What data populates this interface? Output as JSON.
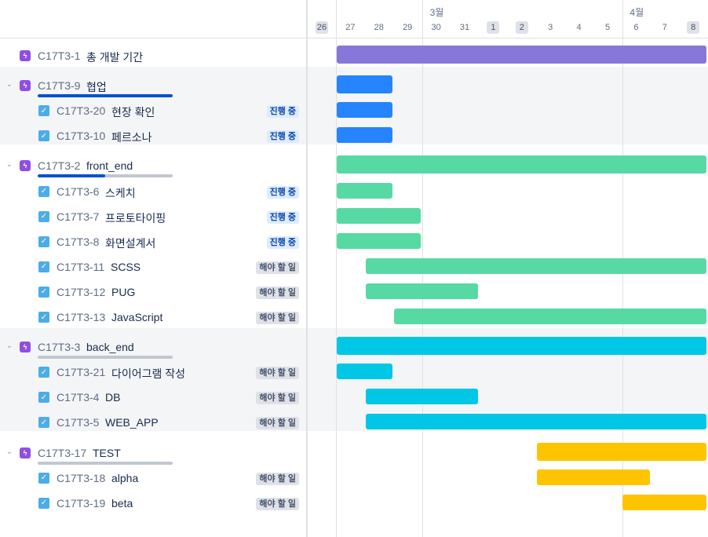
{
  "colors": {
    "epic": "#904ee2",
    "task": "#4bade8",
    "purple": "#8777d9",
    "blue": "#2684ff",
    "green": "#57d9a3",
    "cyan": "#00c7e6",
    "yellow": "#ffc400"
  },
  "timeline": {
    "months": [
      {
        "label": "3월",
        "day_index": 4
      },
      {
        "label": "4월",
        "day_index": 11
      }
    ],
    "days": [
      {
        "label": "26",
        "weekend": true
      },
      {
        "label": "27",
        "weekend": false
      },
      {
        "label": "28",
        "weekend": false
      },
      {
        "label": "29",
        "weekend": false
      },
      {
        "label": "30",
        "weekend": false
      },
      {
        "label": "31",
        "weekend": false
      },
      {
        "label": "1",
        "weekend": true
      },
      {
        "label": "2",
        "weekend": true
      },
      {
        "label": "3",
        "weekend": false
      },
      {
        "label": "4",
        "weekend": false
      },
      {
        "label": "5",
        "weekend": false
      },
      {
        "label": "6",
        "weekend": false
      },
      {
        "label": "7",
        "weekend": false
      },
      {
        "label": "8",
        "weekend": true
      }
    ]
  },
  "rows": [
    {
      "type": "epic",
      "key": "C17T3-1",
      "summary": "총 개발 기간",
      "band": false,
      "chevron": false,
      "progress": null,
      "status": null,
      "bar": {
        "start": 1,
        "end": 13,
        "color": "purple"
      }
    },
    {
      "type": "epic",
      "key": "C17T3-9",
      "summary": "협업",
      "band": true,
      "chevron": true,
      "progress": 1.0,
      "status": null,
      "bar": {
        "start": 1,
        "end": 2,
        "color": "blue"
      }
    },
    {
      "type": "task",
      "key": "C17T3-20",
      "summary": "현장 확인",
      "band": true,
      "status": {
        "label": "진행 중",
        "kind": "inprogress"
      },
      "bar": {
        "start": 1,
        "end": 2,
        "color": "blue"
      }
    },
    {
      "type": "task",
      "key": "C17T3-10",
      "summary": "페르소나",
      "band": true,
      "status": {
        "label": "진행 중",
        "kind": "inprogress"
      },
      "bar": {
        "start": 1,
        "end": 2,
        "color": "blue"
      }
    },
    {
      "type": "epic",
      "key": "C17T3-2",
      "summary": "front_end",
      "band": false,
      "chevron": true,
      "progress": 0.5,
      "status": null,
      "bar": {
        "start": 1,
        "end": 13,
        "color": "green"
      }
    },
    {
      "type": "task",
      "key": "C17T3-6",
      "summary": "스케치",
      "band": false,
      "status": {
        "label": "진행 중",
        "kind": "inprogress"
      },
      "bar": {
        "start": 1,
        "end": 2,
        "color": "green"
      }
    },
    {
      "type": "task",
      "key": "C17T3-7",
      "summary": "프로토타이핑",
      "band": false,
      "status": {
        "label": "진행 중",
        "kind": "inprogress"
      },
      "bar": {
        "start": 1,
        "end": 3,
        "color": "green"
      }
    },
    {
      "type": "task",
      "key": "C17T3-8",
      "summary": "화면설계서",
      "band": false,
      "status": {
        "label": "진행 중",
        "kind": "inprogress"
      },
      "bar": {
        "start": 1,
        "end": 3,
        "color": "green"
      }
    },
    {
      "type": "task",
      "key": "C17T3-11",
      "summary": "SCSS",
      "band": false,
      "status": {
        "label": "해야 할 일",
        "kind": "todo"
      },
      "bar": {
        "start": 2,
        "end": 13,
        "color": "green"
      }
    },
    {
      "type": "task",
      "key": "C17T3-12",
      "summary": "PUG",
      "band": false,
      "status": {
        "label": "해야 할 일",
        "kind": "todo"
      },
      "bar": {
        "start": 2,
        "end": 5,
        "color": "green"
      }
    },
    {
      "type": "task",
      "key": "C17T3-13",
      "summary": "JavaScript",
      "band": false,
      "status": {
        "label": "해야 할 일",
        "kind": "todo"
      },
      "bar": {
        "start": 3,
        "end": 13,
        "color": "green"
      }
    },
    {
      "type": "epic",
      "key": "C17T3-3",
      "summary": "back_end",
      "band": true,
      "chevron": true,
      "progress": 0.0,
      "status": null,
      "bar": {
        "start": 1,
        "end": 13,
        "color": "cyan"
      }
    },
    {
      "type": "task",
      "key": "C17T3-21",
      "summary": "다이어그램 작성",
      "band": true,
      "status": {
        "label": "해야 할 일",
        "kind": "todo"
      },
      "bar": {
        "start": 1,
        "end": 2,
        "color": "cyan"
      }
    },
    {
      "type": "task",
      "key": "C17T3-4",
      "summary": "DB",
      "band": true,
      "status": {
        "label": "해야 할 일",
        "kind": "todo"
      },
      "bar": {
        "start": 2,
        "end": 5,
        "color": "cyan"
      }
    },
    {
      "type": "task",
      "key": "C17T3-5",
      "summary": "WEB_APP",
      "band": true,
      "status": {
        "label": "해야 할 일",
        "kind": "todo"
      },
      "bar": {
        "start": 2,
        "end": 13,
        "color": "cyan"
      }
    },
    {
      "type": "epic",
      "key": "C17T3-17",
      "summary": "TEST",
      "band": false,
      "chevron": true,
      "progress": 0.0,
      "status": null,
      "bar": {
        "start": 8,
        "end": 13,
        "color": "yellow"
      }
    },
    {
      "type": "task",
      "key": "C17T3-18",
      "summary": "alpha",
      "band": false,
      "status": {
        "label": "해야 할 일",
        "kind": "todo"
      },
      "bar": {
        "start": 8,
        "end": 11,
        "color": "yellow"
      }
    },
    {
      "type": "task",
      "key": "C17T3-19",
      "summary": "beta",
      "band": false,
      "status": {
        "label": "해야 할 일",
        "kind": "todo"
      },
      "bar": {
        "start": 11,
        "end": 13,
        "color": "yellow"
      }
    }
  ]
}
